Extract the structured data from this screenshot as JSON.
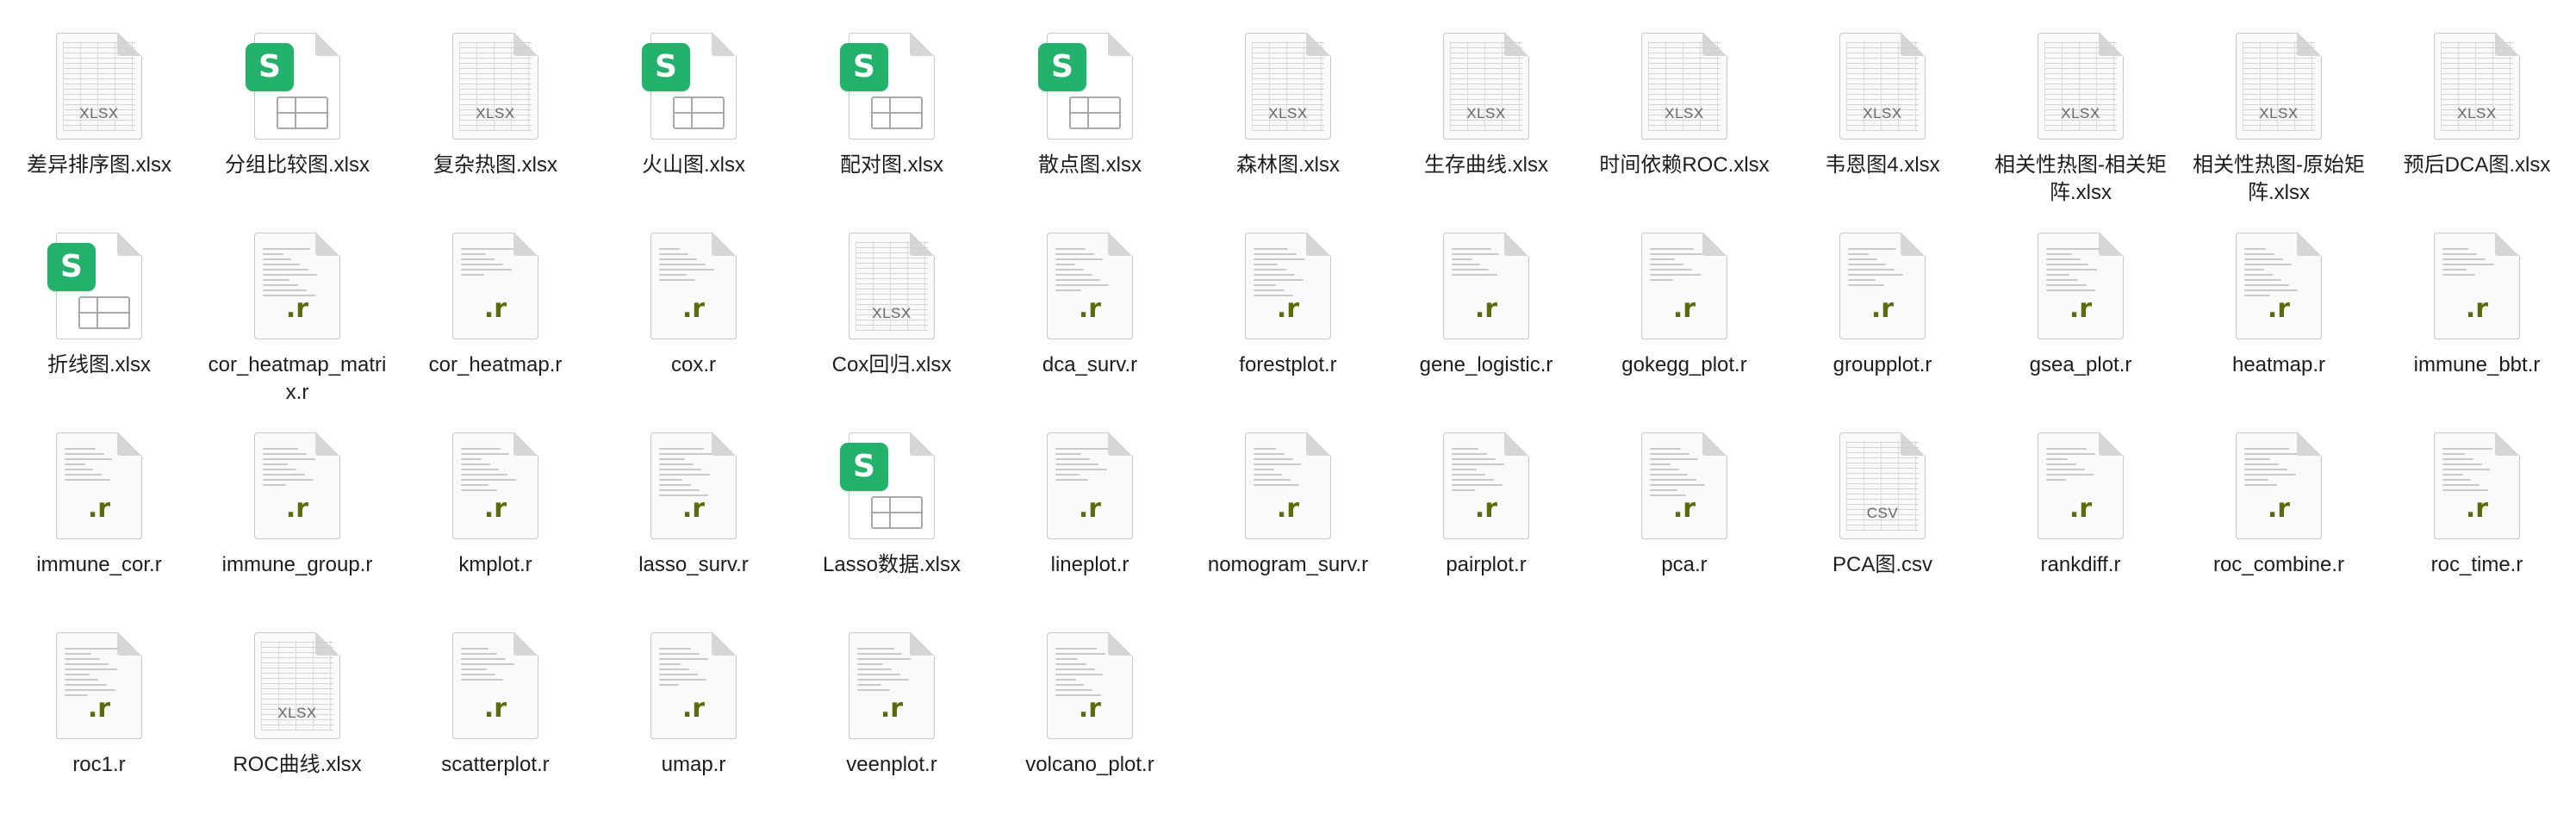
{
  "files": [
    {
      "name": "差异排序图.xlsx",
      "type": "xlsx",
      "ext": "XLSX"
    },
    {
      "name": "分组比较图.xlsx",
      "type": "wps"
    },
    {
      "name": "复杂热图.xlsx",
      "type": "xlsx",
      "ext": "XLSX"
    },
    {
      "name": "火山图.xlsx",
      "type": "wps"
    },
    {
      "name": "配对图.xlsx",
      "type": "wps"
    },
    {
      "name": "散点图.xlsx",
      "type": "wps"
    },
    {
      "name": "森林图.xlsx",
      "type": "xlsx",
      "ext": "XLSX"
    },
    {
      "name": "生存曲线.xlsx",
      "type": "xlsx",
      "ext": "XLSX"
    },
    {
      "name": "时间依赖ROC.xlsx",
      "type": "xlsx",
      "ext": "XLSX"
    },
    {
      "name": "韦恩图4.xlsx",
      "type": "xlsx",
      "ext": "XLSX"
    },
    {
      "name": "相关性热图-相关矩阵.xlsx",
      "type": "xlsx",
      "ext": "XLSX"
    },
    {
      "name": "相关性热图-原始矩阵.xlsx",
      "type": "xlsx",
      "ext": "XLSX"
    },
    {
      "name": "预后DCA图.xlsx",
      "type": "xlsx",
      "ext": "XLSX"
    },
    {
      "name": "折线图.xlsx",
      "type": "wps"
    },
    {
      "name": "cor_heatmap_matrix.r",
      "type": "r",
      "ext": ".r"
    },
    {
      "name": "cor_heatmap.r",
      "type": "r",
      "ext": ".r"
    },
    {
      "name": "cox.r",
      "type": "r",
      "ext": ".r"
    },
    {
      "name": "Cox回归.xlsx",
      "type": "xlsx",
      "ext": "XLSX"
    },
    {
      "name": "dca_surv.r",
      "type": "r",
      "ext": ".r"
    },
    {
      "name": "forestplot.r",
      "type": "r",
      "ext": ".r"
    },
    {
      "name": "gene_logistic.r",
      "type": "r",
      "ext": ".r"
    },
    {
      "name": "gokegg_plot.r",
      "type": "r",
      "ext": ".r"
    },
    {
      "name": "groupplot.r",
      "type": "r",
      "ext": ".r"
    },
    {
      "name": "gsea_plot.r",
      "type": "r",
      "ext": ".r"
    },
    {
      "name": "heatmap.r",
      "type": "r",
      "ext": ".r"
    },
    {
      "name": "immune_bbt.r",
      "type": "r",
      "ext": ".r"
    },
    {
      "name": "immune_cor.r",
      "type": "r",
      "ext": ".r"
    },
    {
      "name": "immune_group.r",
      "type": "r",
      "ext": ".r"
    },
    {
      "name": "kmplot.r",
      "type": "r",
      "ext": ".r"
    },
    {
      "name": "lasso_surv.r",
      "type": "r",
      "ext": ".r"
    },
    {
      "name": "Lasso数据.xlsx",
      "type": "wps"
    },
    {
      "name": "lineplot.r",
      "type": "r",
      "ext": ".r"
    },
    {
      "name": "nomogram_surv.r",
      "type": "r",
      "ext": ".r"
    },
    {
      "name": "pairplot.r",
      "type": "r",
      "ext": ".r"
    },
    {
      "name": "pca.r",
      "type": "r",
      "ext": ".r"
    },
    {
      "name": "PCA图.csv",
      "type": "csv",
      "ext": "CSV"
    },
    {
      "name": "rankdiff.r",
      "type": "r",
      "ext": ".r"
    },
    {
      "name": "roc_combine.r",
      "type": "r",
      "ext": ".r"
    },
    {
      "name": "roc_time.r",
      "type": "r",
      "ext": ".r"
    },
    {
      "name": "roc1.r",
      "type": "r",
      "ext": ".r"
    },
    {
      "name": "ROC曲线.xlsx",
      "type": "xlsx",
      "ext": "XLSX"
    },
    {
      "name": "scatterplot.r",
      "type": "r",
      "ext": ".r"
    },
    {
      "name": "umap.r",
      "type": "r",
      "ext": ".r"
    },
    {
      "name": "veenplot.r",
      "type": "r",
      "ext": ".r"
    },
    {
      "name": "volcano_plot.r",
      "type": "r",
      "ext": ".r"
    }
  ],
  "wps_badge_letter": "S",
  "colors": {
    "wps_green": "#23b26b",
    "r_ext": "#5b6b0e"
  }
}
